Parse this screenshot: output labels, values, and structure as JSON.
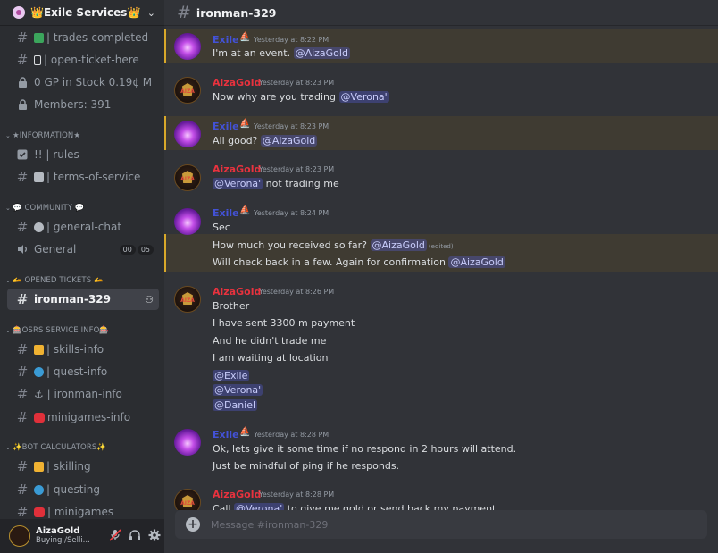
{
  "server": {
    "name": "👑Exile Services👑"
  },
  "channels": {
    "top": [
      {
        "name": "trades-completed",
        "prefix": "| ",
        "emoji_color": "#3ba55c",
        "icon": "hash-icon"
      },
      {
        "name": "open-ticket-here",
        "prefix": "| ",
        "emoji_color": "#ffffff",
        "icon": "hash-icon"
      },
      {
        "name": "0 GP in Stock 0.19¢ M",
        "icon": "lock-icon"
      },
      {
        "name": "Members: 391",
        "icon": "lock-icon"
      }
    ],
    "categories": [
      {
        "label": "★INFORMATION★",
        "items": [
          {
            "name": "rules",
            "prefix": "!! | ",
            "icon": "check-square-icon"
          },
          {
            "name": "terms-of-service",
            "prefix": "| ",
            "emoji_color": "#b5bac1",
            "icon": "hash-icon"
          }
        ]
      },
      {
        "label": "💬 COMMUNITY 💬",
        "items": [
          {
            "name": "general-chat",
            "prefix": "| ",
            "emoji_color": "#b5bac1",
            "icon": "hash-icon"
          },
          {
            "name": "General",
            "icon": "speaker-icon",
            "badges": [
              "00",
              "05"
            ]
          }
        ]
      },
      {
        "label": "🫴 OPENED TICKETS 🫴",
        "items": [
          {
            "name": "ironman-329",
            "icon": "hash-icon",
            "active": true
          }
        ]
      },
      {
        "label": "🎰OSRS SERVICE INFO🎰",
        "items": [
          {
            "name": "skills-info",
            "prefix": "| ",
            "emoji_color": "#f0b232",
            "icon": "hash-icon"
          },
          {
            "name": "quest-info",
            "prefix": "| ",
            "emoji_color": "#3a9bd5",
            "icon": "hash-icon"
          },
          {
            "name": "ironman-info",
            "prefix": "⚓ | ",
            "icon": "hash-icon"
          },
          {
            "name": "minigames-info",
            "prefix": "",
            "emoji_color": "#e0303a",
            "icon": "hash-icon"
          }
        ]
      },
      {
        "label": "✨BOT CALCULATORS✨",
        "items": [
          {
            "name": "skilling",
            "prefix": "| ",
            "emoji_color": "#f0b232",
            "icon": "hash-icon"
          },
          {
            "name": "questing",
            "prefix": "| ",
            "emoji_color": "#3a9bd5",
            "icon": "hash-icon"
          },
          {
            "name": "minigames",
            "prefix": "| ",
            "emoji_color": "#e0303a",
            "icon": "hash-icon"
          }
        ]
      }
    ]
  },
  "user_panel": {
    "name": "AizaGold",
    "status": "Buying /Selli..."
  },
  "channel_header": {
    "title": "ironman-329"
  },
  "messages": [
    {
      "author": "Exile",
      "time": "Yesterday at 8:22 PM",
      "highlight": true,
      "lines": [
        [
          "I'm at an event. ",
          "@AizaGold"
        ]
      ]
    },
    {
      "author": "AizaGold",
      "time": "Yesterday at 8:23 PM",
      "highlight": false,
      "lines": [
        [
          "Now why are you trading ",
          "@Verona'"
        ]
      ]
    },
    {
      "author": "Exile",
      "time": "Yesterday at 8:23 PM",
      "highlight": true,
      "lines": [
        [
          "All good? ",
          "@AizaGold"
        ]
      ]
    },
    {
      "author": "AizaGold",
      "time": "Yesterday at 8:23 PM",
      "highlight": false,
      "lines": [
        [
          "",
          "@Verona'",
          " not trading me"
        ]
      ]
    },
    {
      "author": "Exile",
      "time": "Yesterday at 8:24 PM",
      "highlight": false,
      "lines": [
        [
          "Sec"
        ],
        [
          "How much you received so far? ",
          "@AizaGold",
          "(edited)"
        ],
        [
          "Will check back in a few. Again for confirmation ",
          "@AizaGold"
        ]
      ]
    },
    {
      "author": "AizaGold",
      "time": "Yesterday at 8:26 PM",
      "highlight": false,
      "lines": [
        [
          "Brother"
        ],
        [
          "I have sent 3300 m payment"
        ],
        [
          "And he didn't trade me"
        ],
        [
          "I am waiting at location"
        ],
        [
          "",
          "@Exile"
        ],
        [
          "",
          "@Verona'"
        ],
        [
          "",
          "@Daniel"
        ]
      ]
    },
    {
      "author": "Exile",
      "time": "Yesterday at 8:28 PM",
      "highlight": false,
      "lines": [
        [
          "Ok, lets give it some time if no respond in 2 hours will attend."
        ],
        [
          "Just be mindful of ping if he responds."
        ]
      ]
    },
    {
      "author": "AizaGold",
      "time": "Yesterday at 8:28 PM",
      "highlight": false,
      "lines": [
        [
          "Call ",
          "@Verona'",
          " to give me gold or send back my payment"
        ]
      ]
    }
  ],
  "composer": {
    "placeholder": "Message #ironman-329"
  }
}
